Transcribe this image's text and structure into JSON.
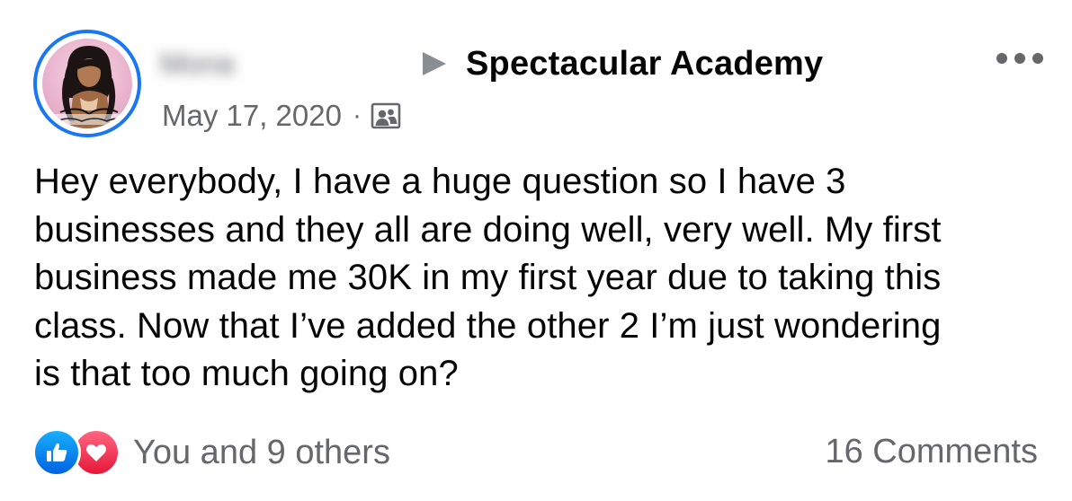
{
  "post": {
    "author_name": "Mona",
    "group_name": "Spectacular Academy",
    "date": "May 17, 2020",
    "separator": "·",
    "audience_icon": "group-members-icon",
    "body_lines": [
      "Hey everybody, I have a huge question so I have 3",
      "businesses and they all are doing well, very well. My first",
      "business made me 30K in my first year due to taking this",
      "class. Now that I’ve added the other 2 I’m just wondering",
      "is that too much going on?"
    ],
    "reactions_text": "You and 9 others",
    "comments_text": "16 Comments",
    "reaction_icons": [
      "like-icon",
      "love-icon"
    ]
  },
  "colors": {
    "accent_blue": "#1a77f2",
    "secondary_text": "#65676b",
    "primary_text": "#050505",
    "like_blue": "#0a7cff",
    "love_red": "#f33e58"
  }
}
